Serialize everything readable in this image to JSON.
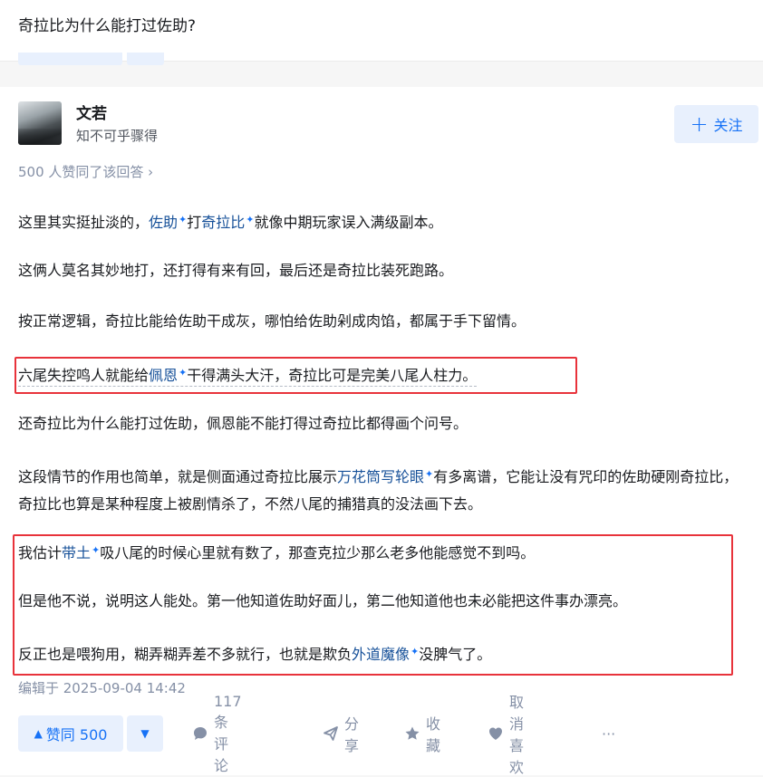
{
  "question": {
    "title": "奇拉比为什么能打过佐助?"
  },
  "author": {
    "name": "文若",
    "bio": "知不可乎骤得",
    "follow_label": "关注"
  },
  "upvote_summary": "500 人赞同了该回答 ›",
  "paragraphs": {
    "p1": {
      "a": "这里其实挺扯淡的，",
      "k1": "佐助",
      "b": "打",
      "k2": "奇拉比",
      "c": "就像中期玩家误入满级副本。"
    },
    "p2": "这俩人莫名其妙地打，还打得有来有回，最后还是奇拉比装死跑路。",
    "p3": "按正常逻辑，奇拉比能给佐助干成灰，哪怕给佐助剁成肉馅，都属于手下留情。",
    "p4": {
      "a": "六尾失控鸣人就能给",
      "k1": "佩恩",
      "b": "干得满头大汗，奇拉比可是完美八尾人柱力。"
    },
    "p5": "还奇拉比为什么能打过佐助，佩恩能不能打得过奇拉比都得画个问号。",
    "p6": {
      "a": "这段情节的作用也简单，就是侧面通过奇拉比展示",
      "k1": "万花筒写轮眼",
      "b": "有多离谱，它能让没有咒印的佐助硬刚奇拉比，奇拉比也算是某种程度上被剧情杀了，不然八尾的捕猎真的没法画下去。"
    },
    "p7": {
      "a": "我估计",
      "k1": "带土",
      "b": "吸八尾的时候心里就有数了，那查克拉少那么老多他能感觉不到吗。"
    },
    "p8": "但是他不说，说明这人能处。第一他知道佐助好面儿，第二他知道他也未必能把这件事办漂亮。",
    "p9": {
      "a": "反正也是喂狗用，糊弄糊弄差不多就行，也就是欺负",
      "k1": "外道魔像",
      "b": "没脾气了。"
    }
  },
  "keyword_icon": "sparkle-icon",
  "edit_time": "编辑于 2025-09-04 14:42",
  "actions": {
    "upvote_label": "赞同 500",
    "comments_label": "117 条评论",
    "share_label": "分享",
    "collect_label": "收藏",
    "unlike_label": "取消喜欢",
    "more_label": "···"
  },
  "colors": {
    "accent": "#1772f6",
    "keyword": "#175199",
    "highlight_border": "#e8333b",
    "muted": "#8590a6"
  }
}
